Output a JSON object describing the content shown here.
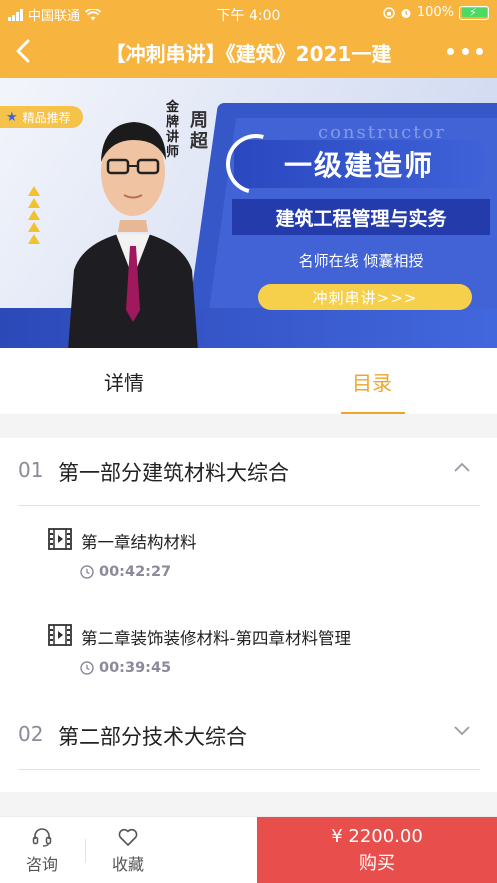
{
  "status_bar": {
    "carrier": "中国联通",
    "time": "下午 4:00",
    "battery": "100%"
  },
  "nav": {
    "title": "【冲刺串讲】《建筑》2021一建",
    "back_icon": "back-arrow-icon",
    "more_icon": "more-dots-icon"
  },
  "banner": {
    "badge": "精品推荐",
    "teacher_tag": "金牌讲师",
    "teacher_name": "周超",
    "constructor_word": "constructor",
    "level": "一级建造师",
    "subject": "建筑工程管理与实务",
    "slogan": "名师在线 倾囊相授",
    "cta": "冲刺串讲>>>"
  },
  "tabs": {
    "detail": "详情",
    "catalog": "目录",
    "active": "catalog",
    "active_color": "#f0a52a"
  },
  "catalog": {
    "sections": [
      {
        "num": "01",
        "title": "第一部分建筑材料大综合",
        "expanded": true,
        "lessons": [
          {
            "title": "第一章结构材料",
            "duration": "00:42:27"
          },
          {
            "title": "第二章装饰装修材料-第四章材料管理",
            "duration": "00:39:45"
          }
        ]
      },
      {
        "num": "02",
        "title": "第二部分技术大综合",
        "expanded": false,
        "lessons": []
      }
    ]
  },
  "bottom_bar": {
    "consult": "咨询",
    "favorite": "收藏",
    "price": "¥ 2200.00",
    "buy": "购买",
    "buy_color": "#e84f4c"
  }
}
